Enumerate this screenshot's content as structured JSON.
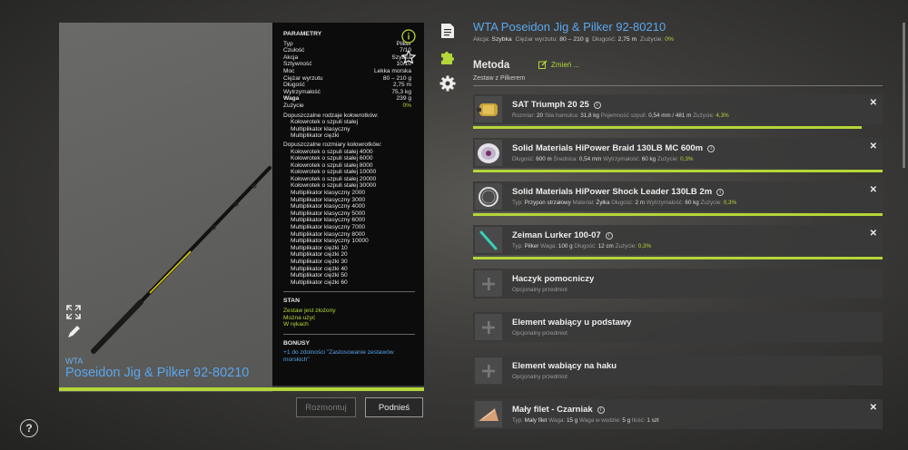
{
  "colors": {
    "accent": "#b4d638",
    "title_blue": "#5aa8ee"
  },
  "rod": {
    "brand": "WTA",
    "name": "Poseidon Jig & Pilker 92-80210",
    "params_header": "PARAMETRY",
    "params": [
      {
        "label": "Typ",
        "value": "Pilker"
      },
      {
        "label": "Czułość",
        "value": "7/10"
      },
      {
        "label": "Akcja",
        "value": "Szybka"
      },
      {
        "label": "Sztywność",
        "value": "10/10"
      },
      {
        "label": "Moc",
        "value": "Lekka morska"
      },
      {
        "label": "Ciężar wyrzutu",
        "value": "80 – 210 g"
      },
      {
        "label": "Długość",
        "value": "2,75 m"
      },
      {
        "label": "Wytrzymałość",
        "value": "75,3 kg"
      },
      {
        "label": "Waga",
        "value": "239 g"
      },
      {
        "label": "Zużycie",
        "value": "0%"
      }
    ],
    "reel_types_header": "Dopuszczalne rodzaje kołowrotków:",
    "reel_types": [
      "Kołowrotek o szpuli stałej",
      "Multiplikator klasyczny",
      "Multiplikator ciężki"
    ],
    "reel_sizes_header": "Dopuszczalne rozmiary kołowrotków:",
    "reel_sizes": [
      "Kołowrotek o szpuli stałej 4000",
      "Kołowrotek o szpuli stałej 6000",
      "Kołowrotek o szpuli stałej 8000",
      "Kołowrotek o szpuli stałej 10000",
      "Kołowrotek o szpuli stałej 20000",
      "Kołowrotek o szpuli stałej 30000",
      "Multiplikator klasyczny 2000",
      "Multiplikator klasyczny 3000",
      "Multiplikator klasyczny 4000",
      "Multiplikator klasyczny 5000",
      "Multiplikator klasyczny 6000",
      "Multiplikator klasyczny 7000",
      "Multiplikator klasyczny 8000",
      "Multiplikator klasyczny 10000",
      "Multiplikator ciężki 10",
      "Multiplikator ciężki 20",
      "Multiplikator ciężki 30",
      "Multiplikator ciężki 40",
      "Multiplikator ciężki 50",
      "Multiplikator ciężki 60"
    ],
    "state_header": "STAN",
    "state": [
      "Zestaw jest złożony",
      "Można użyć",
      "W rękach"
    ],
    "bonus_header": "BONUSY",
    "bonus_text": "+1 do zdolności \"Zastosowanie zestawów morskich\"",
    "buttons": {
      "disassemble": "Rozmontuj",
      "pickup": "Podnieś"
    }
  },
  "tackle": {
    "title": "WTA Poseidon Jig & Pilker 92-80210",
    "summary": {
      "akcja_label": "Akcja:",
      "akcja": "Szybka",
      "ciezar_label": "Ciężar wyrzutu:",
      "ciezar": "80 – 210 g",
      "dlugosc_label": "Długość:",
      "dlugosc": "2,75 m",
      "zuzycie_label": "Zużycie:",
      "zuzycie": "0%"
    },
    "method_label": "Metoda",
    "change_label": "Zmień ...",
    "method_value": "Zestaw z Pilkerem",
    "slots": [
      {
        "name": "SAT Triumph 20 25",
        "info": true,
        "remove": "✕",
        "attrs": [
          [
            "Rozmiar:",
            "20"
          ],
          [
            "Siła hamulca:",
            "31,8 kg"
          ],
          [
            "Pojemność szpuli:",
            "0,54 mm / 481 m"
          ],
          [
            "Zużycie:",
            "4,3%"
          ]
        ]
      },
      {
        "name": "Solid Materials HiPower Braid 130LB MC 600m",
        "info": true,
        "remove": "✕",
        "attrs": [
          [
            "Długość:",
            "600 m"
          ],
          [
            "Średnica:",
            "0,54 mm"
          ],
          [
            "Wytrzymałość:",
            "60 kg"
          ],
          [
            "Zużycie:",
            "0,3%"
          ]
        ]
      },
      {
        "name": "Solid Materials HiPower Shock Leader 130LB 2m",
        "info": true,
        "remove": "✕",
        "attrs": [
          [
            "Typ:",
            "Przypon strzałowy"
          ],
          [
            "Materiał:",
            "Żyłka"
          ],
          [
            "Długość:",
            "2 m"
          ],
          [
            "Wytrzymałość:",
            "60 kg"
          ],
          [
            "Zużycie:",
            "0,3%"
          ]
        ]
      },
      {
        "name": "Zeiman Lurker 100-07",
        "info": true,
        "remove": "✕",
        "attrs": [
          [
            "Typ:",
            "Pilker"
          ],
          [
            "Waga:",
            "100 g"
          ],
          [
            "Długość:",
            "12 cm"
          ],
          [
            "Zużycie:",
            "0,3%"
          ]
        ]
      },
      {
        "name": "Haczyk pomocniczy",
        "sub": "Opcjonalny przedmiot"
      },
      {
        "name": "Element wabiący u podstawy",
        "sub": "Opcjonalny przedmiot"
      },
      {
        "name": "Element wabiący na haku",
        "sub": "Opcjonalny przedmiot"
      },
      {
        "name": "Mały filet - Czarniak",
        "info": true,
        "remove": "✕",
        "attrs": [
          [
            "Typ:",
            "Mały filet"
          ],
          [
            "Waga:",
            "15 g"
          ],
          [
            "Waga w wodzie:",
            "5 g"
          ],
          [
            "Ilość:",
            "1 szt"
          ]
        ]
      }
    ],
    "slot_fill": [
      0.95,
      1.0,
      1.0,
      1.0
    ]
  },
  "help": "?"
}
